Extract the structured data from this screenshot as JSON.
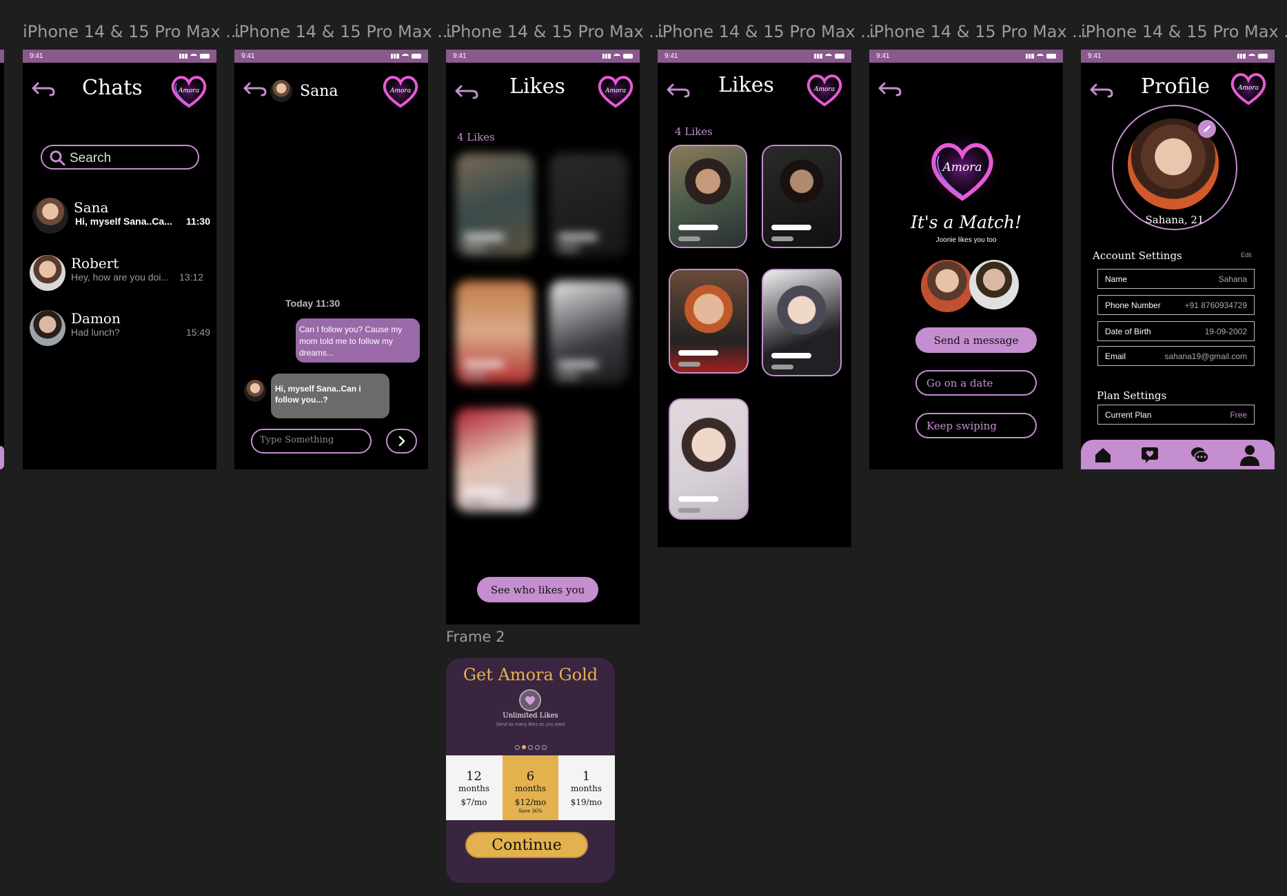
{
  "frames": [
    {
      "label": "iPhone 14 & 15 Pro Max ..."
    },
    {
      "label": "iPhone 14 & 15 Pro Max ..."
    },
    {
      "label": "iPhone 14 & 15 Pro Max ..."
    },
    {
      "label": "iPhone 14 & 15 Pro Max ..."
    },
    {
      "label": "iPhone 14 & 15 Pro Max ..."
    },
    {
      "label": "iPhone 14 & 15 Pro Max ..."
    }
  ],
  "frame2_label": "Frame 2",
  "status_time": "9:41",
  "logo_text": "Amora",
  "chats": {
    "title": "Chats",
    "search_placeholder": "Search",
    "items": [
      {
        "name": "Sana",
        "message": "Hi, myself  Sana..Ca...",
        "time": "11:30"
      },
      {
        "name": "Robert",
        "message": "Hey, how are you doi...",
        "time": "13:12"
      },
      {
        "name": "Damon",
        "message": "Had lunch?",
        "time": "15:49"
      }
    ]
  },
  "conversation": {
    "contact": "Sana",
    "date_stamp": "Today 11:30",
    "outgoing": "Can I follow you? Cause my mom told me to follow my dreams...",
    "incoming": "Hi, myself  Sana..Can i follow you...?",
    "input_placeholder": "Type Something"
  },
  "likes_blurred": {
    "title": "Likes",
    "count_label": "4 Likes",
    "cta": "See who likes you"
  },
  "likes_revealed": {
    "title": "Likes",
    "count_label": "4 Likes"
  },
  "match": {
    "title": "It's a Match!",
    "subtitle": "Joonie  likes you too",
    "send_message": "Send a message",
    "go_date": "Go on a date",
    "keep_swiping": "Keep swiping"
  },
  "profile": {
    "title": "Profile",
    "name_age": "Sahana, 21",
    "account_settings": "Account Settings",
    "edit": "Edit",
    "fields": [
      {
        "label": "Name",
        "value": "Sahana"
      },
      {
        "label": "Phone Number",
        "value": "+91 8760934729"
      },
      {
        "label": "Date of Birth",
        "value": "19-09-2002"
      },
      {
        "label": "Email",
        "value": "sahana19@gmail.com"
      }
    ],
    "plan_settings": "Plan Settings",
    "plan_label": "Current Plan",
    "plan_value": "Free"
  },
  "gold": {
    "title": "Get Amora Gold",
    "feature": "Unlimited Likes",
    "feature_sub": "Send as many likes as you want",
    "plans": [
      {
        "num": "12",
        "unit": "months",
        "price": "$7/mo",
        "note": ""
      },
      {
        "num": "6",
        "unit": "months",
        "price": "$12/mo",
        "note": "Save 36%"
      },
      {
        "num": "1",
        "unit": "months",
        "price": "$19/mo",
        "note": ""
      }
    ],
    "continue": "Continue"
  },
  "colors": {
    "accent": "#c58ed0",
    "statusbar": "#8a5a8e",
    "gold": "#e3b24f",
    "gold_bg": "#3a2540"
  }
}
